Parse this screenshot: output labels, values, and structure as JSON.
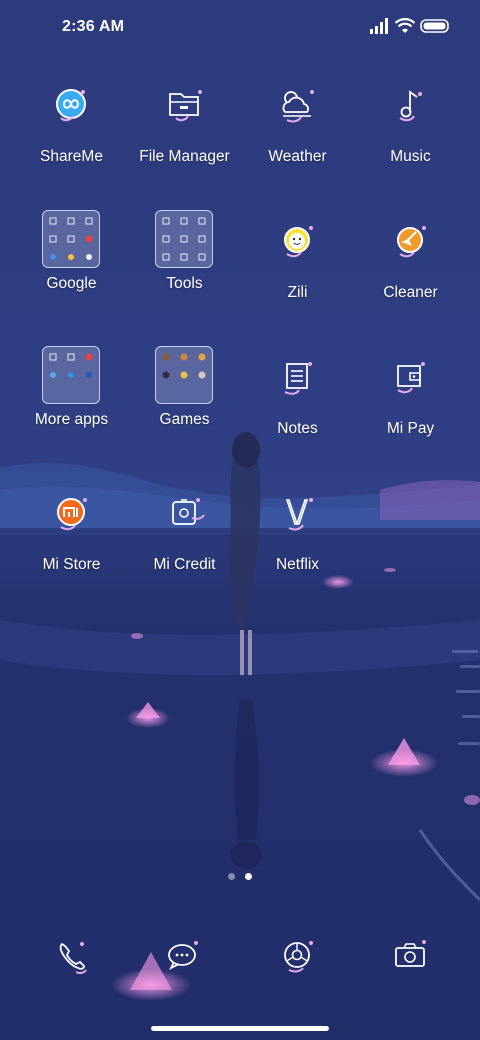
{
  "status_bar": {
    "time": "2:36 AM",
    "signal_icon": "signal-bars-icon",
    "wifi_icon": "wifi-icon",
    "battery_icon": "battery-icon"
  },
  "apps": [
    {
      "label": "ShareMe",
      "icon": "shareme-icon"
    },
    {
      "label": "File Manager",
      "icon": "folder-icon"
    },
    {
      "label": "Weather",
      "icon": "weather-icon"
    },
    {
      "label": "Music",
      "icon": "music-note-icon"
    },
    {
      "label": "Google",
      "icon": "google-folder-icon"
    },
    {
      "label": "Tools",
      "icon": "tools-folder-icon"
    },
    {
      "label": "Zili",
      "icon": "zili-icon"
    },
    {
      "label": "Cleaner",
      "icon": "broom-icon"
    },
    {
      "label": "More apps",
      "icon": "more-apps-folder-icon"
    },
    {
      "label": "Games",
      "icon": "games-folder-icon"
    },
    {
      "label": "Notes",
      "icon": "notes-icon"
    },
    {
      "label": "Mi Pay",
      "icon": "wallet-icon"
    },
    {
      "label": "Mi Store",
      "icon": "mi-store-icon"
    },
    {
      "label": "Mi Credit",
      "icon": "mi-credit-icon"
    },
    {
      "label": "Netflix",
      "icon": "netflix-icon"
    }
  ],
  "page_indicator": {
    "total": 2,
    "current": 2
  },
  "dock": [
    {
      "icon": "phone-icon"
    },
    {
      "icon": "messages-icon"
    },
    {
      "icon": "browser-icon"
    },
    {
      "icon": "camera-icon"
    }
  ],
  "colors": {
    "accent": "#e8a9ec",
    "line": "#ffffff",
    "sky": "#2c3a7a",
    "water": "#1f2c66"
  }
}
